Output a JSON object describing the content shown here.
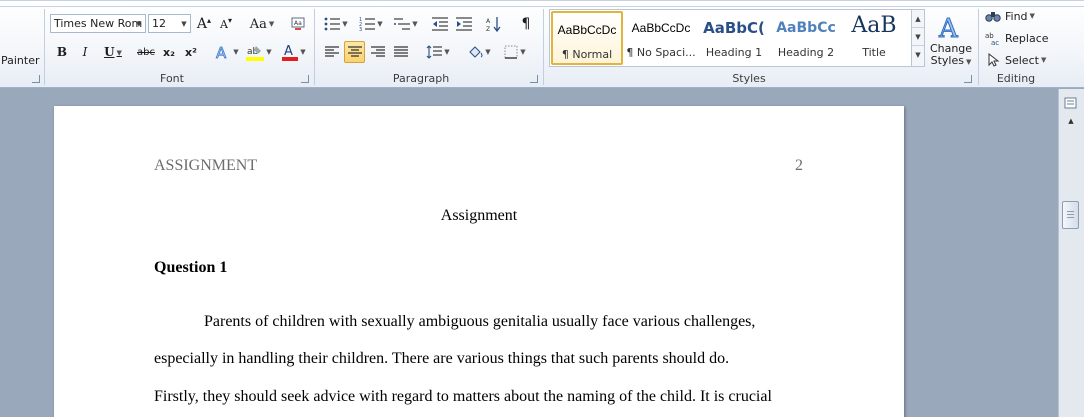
{
  "ribbon": {
    "clipboard": {
      "painter_label": "Painter"
    },
    "font": {
      "group_label": "Font",
      "font_name": "Times New Rom",
      "font_size": "12",
      "bold": "B",
      "italic": "I",
      "underline": "U",
      "strikethrough": "abc",
      "subscript": "x₂",
      "superscript": "x²",
      "grow_font": "A",
      "shrink_font": "A",
      "change_case": "Aa",
      "font_color": "#e02020",
      "highlight_color": "#ffff00"
    },
    "paragraph": {
      "group_label": "Paragraph",
      "pilcrow": "¶"
    },
    "styles": {
      "group_label": "Styles",
      "items": [
        {
          "sample": "AaBbCcDc",
          "name": "¶ Normal",
          "selected": true
        },
        {
          "sample": "AaBbCcDc",
          "name": "¶ No Spaci..."
        },
        {
          "sample": "AaBbC(",
          "name": "Heading 1"
        },
        {
          "sample": "AaBbCc",
          "name": "Heading 2"
        },
        {
          "sample": "AaB",
          "name": "Title"
        }
      ],
      "change_styles_line1": "Change",
      "change_styles_line2": "Styles"
    },
    "editing": {
      "group_label": "Editing",
      "find": "Find",
      "replace": "Replace",
      "select": "Select"
    }
  },
  "document": {
    "header_left": "ASSIGNMENT",
    "header_page": "2",
    "title": "Assignment",
    "question": "Question 1",
    "lines": [
      "Parents of children with sexually ambiguous genitalia usually face various challenges,",
      "especially in handling their children. There are various things that such parents should do.",
      "Firstly, they should seek advice with regard to matters about the naming of the child. It is crucial"
    ]
  }
}
